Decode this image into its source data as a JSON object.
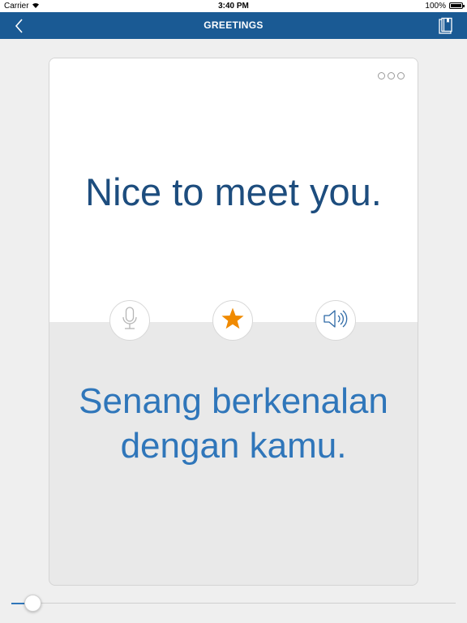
{
  "status_bar": {
    "carrier": "Carrier",
    "time": "3:40 PM",
    "battery": "100%"
  },
  "nav": {
    "title": "GREETINGS"
  },
  "card": {
    "phrase": "Nice to meet you.",
    "translation": "Senang berkenalan dengan kamu.",
    "starred": true
  },
  "slider": {
    "position_fraction": 0.05
  },
  "colors": {
    "nav_bar": "#1a5a94",
    "phrase_text": "#1d4d7e",
    "translation_text": "#2f76ba",
    "star": "#f08a00"
  },
  "icons": {
    "back": "chevron-left-icon",
    "book": "phrasebook-icon",
    "more": "more-dots-icon",
    "mic": "microphone-icon",
    "star": "star-icon",
    "speaker": "speaker-icon"
  }
}
